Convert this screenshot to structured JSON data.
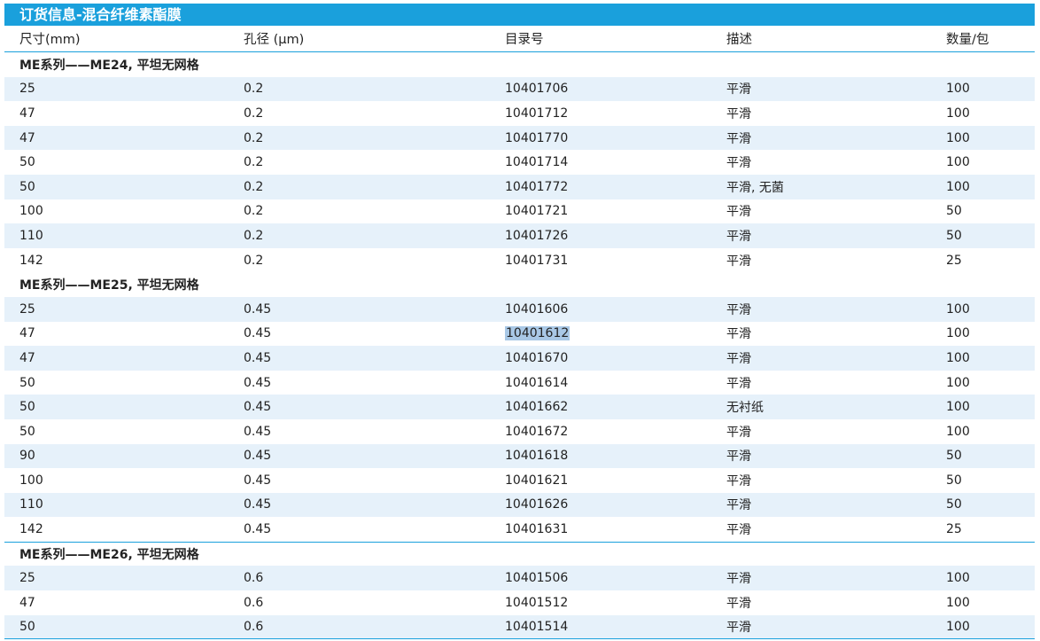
{
  "title": "订货信息-混合纤维素酯膜",
  "columns": [
    "尺寸(mm)",
    "孔径 (μm)",
    "目录号",
    "描述",
    "数量/包"
  ],
  "groups": [
    {
      "name": "ME系列——ME24, 平坦无网格",
      "rows": [
        [
          "25",
          "0.2",
          "10401706",
          "平滑",
          "100"
        ],
        [
          "47",
          "0.2",
          "10401712",
          "平滑",
          "100"
        ],
        [
          "47",
          "0.2",
          "10401770",
          "平滑",
          "100"
        ],
        [
          "50",
          "0.2",
          "10401714",
          "平滑",
          "100"
        ],
        [
          "50",
          "0.2",
          "10401772",
          "平滑, 无菌",
          "100"
        ],
        [
          "100",
          "0.2",
          "10401721",
          "平滑",
          "50"
        ],
        [
          "110",
          "0.2",
          "10401726",
          "平滑",
          "50"
        ],
        [
          "142",
          "0.2",
          "10401731",
          "平滑",
          "25"
        ]
      ]
    },
    {
      "name": "ME系列——ME25, 平坦无网格",
      "rows": [
        [
          "25",
          "0.45",
          "10401606",
          "平滑",
          "100"
        ],
        [
          "47",
          "0.45",
          "10401612",
          "平滑",
          "100"
        ],
        [
          "47",
          "0.45",
          "10401670",
          "平滑",
          "100"
        ],
        [
          "50",
          "0.45",
          "10401614",
          "平滑",
          "100"
        ],
        [
          "50",
          "0.45",
          "10401662",
          "无衬纸",
          "100"
        ],
        [
          "50",
          "0.45",
          "10401672",
          "平滑",
          "100"
        ],
        [
          "90",
          "0.45",
          "10401618",
          "平滑",
          "50"
        ],
        [
          "100",
          "0.45",
          "10401621",
          "平滑",
          "50"
        ],
        [
          "110",
          "0.45",
          "10401626",
          "平滑",
          "50"
        ],
        [
          "142",
          "0.45",
          "10401631",
          "平滑",
          "25"
        ]
      ]
    },
    {
      "name": "ME系列——ME26, 平坦无网格",
      "rows": [
        [
          "25",
          "0.6",
          "10401506",
          "平滑",
          "100"
        ],
        [
          "47",
          "0.6",
          "10401512",
          "平滑",
          "100"
        ],
        [
          "50",
          "0.6",
          "10401514",
          "平滑",
          "100"
        ]
      ]
    }
  ],
  "selected_catalog": "10401612",
  "colors": {
    "accent": "#1aa0dc",
    "row_shade": "#e6f1fa",
    "selection": "#a9c8e6"
  }
}
